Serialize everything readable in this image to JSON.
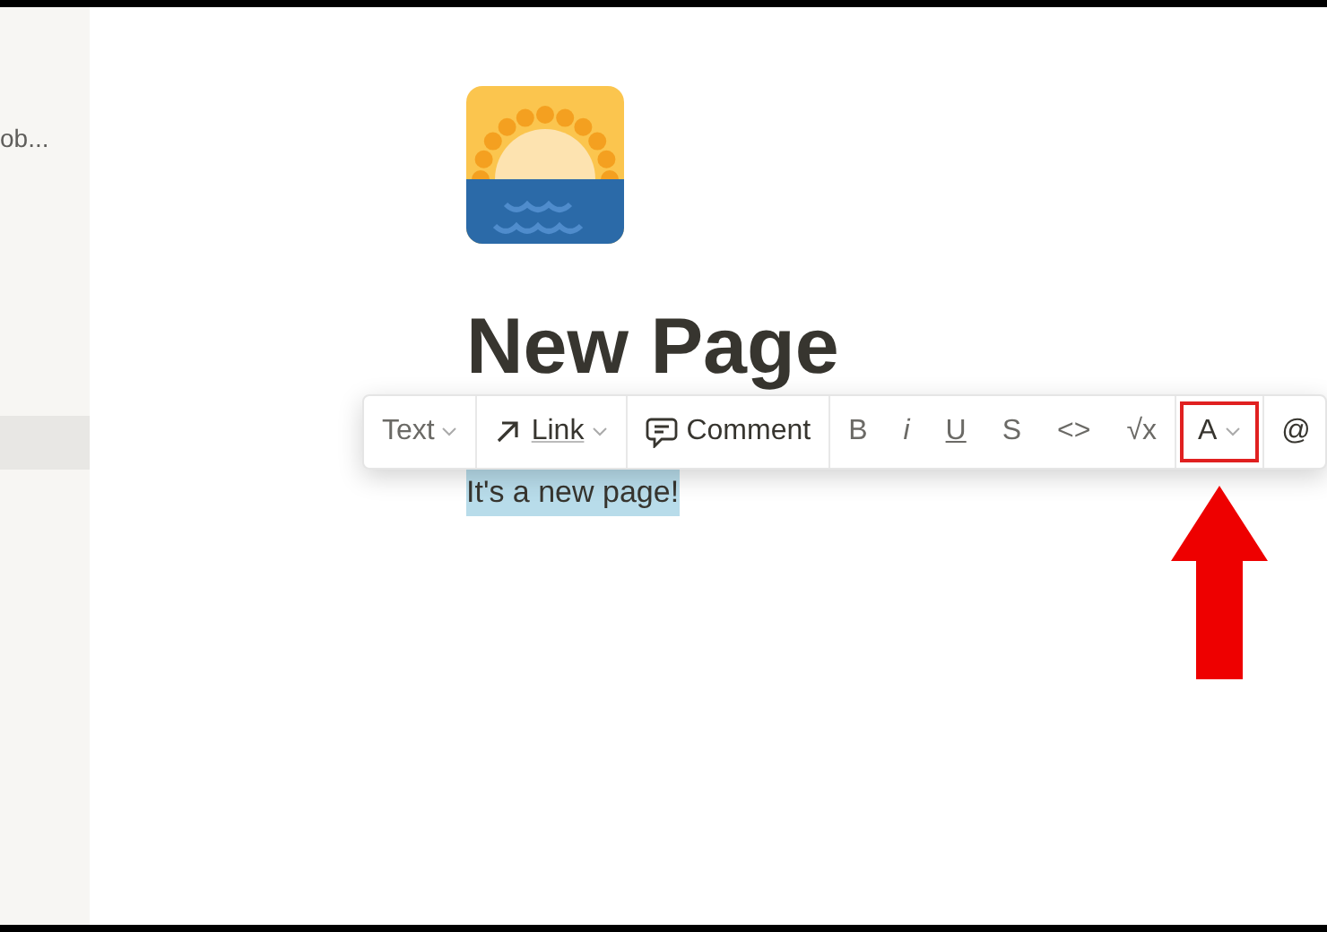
{
  "sidebar": {
    "items": [
      {
        "label": "ob...",
        "selected": false
      },
      {
        "selected": true
      }
    ]
  },
  "page": {
    "title": "New Page",
    "body": "It's a new page!",
    "body_selected": true
  },
  "toolbar": {
    "items": [
      {
        "kind": "text",
        "label": "Text",
        "dropdown": true,
        "annotated": false
      },
      {
        "kind": "link",
        "label": "Link",
        "dropdown": true,
        "annotated": false
      },
      {
        "kind": "comment",
        "label": "Comment",
        "dropdown": false,
        "annotated": false
      },
      {
        "kind": "bold",
        "label": "B",
        "dropdown": false,
        "annotated": false
      },
      {
        "kind": "italic",
        "label": "i",
        "dropdown": false,
        "annotated": false
      },
      {
        "kind": "underline",
        "label": "U",
        "dropdown": false,
        "annotated": false
      },
      {
        "kind": "strike",
        "label": "S",
        "dropdown": false,
        "annotated": false
      },
      {
        "kind": "code",
        "label": "<>",
        "dropdown": false,
        "annotated": false
      },
      {
        "kind": "math",
        "label": "√x",
        "dropdown": false,
        "annotated": false
      },
      {
        "kind": "color",
        "label": "A",
        "dropdown": true,
        "annotated": true
      },
      {
        "kind": "mention",
        "label": "@",
        "dropdown": false,
        "annotated": false
      }
    ]
  }
}
